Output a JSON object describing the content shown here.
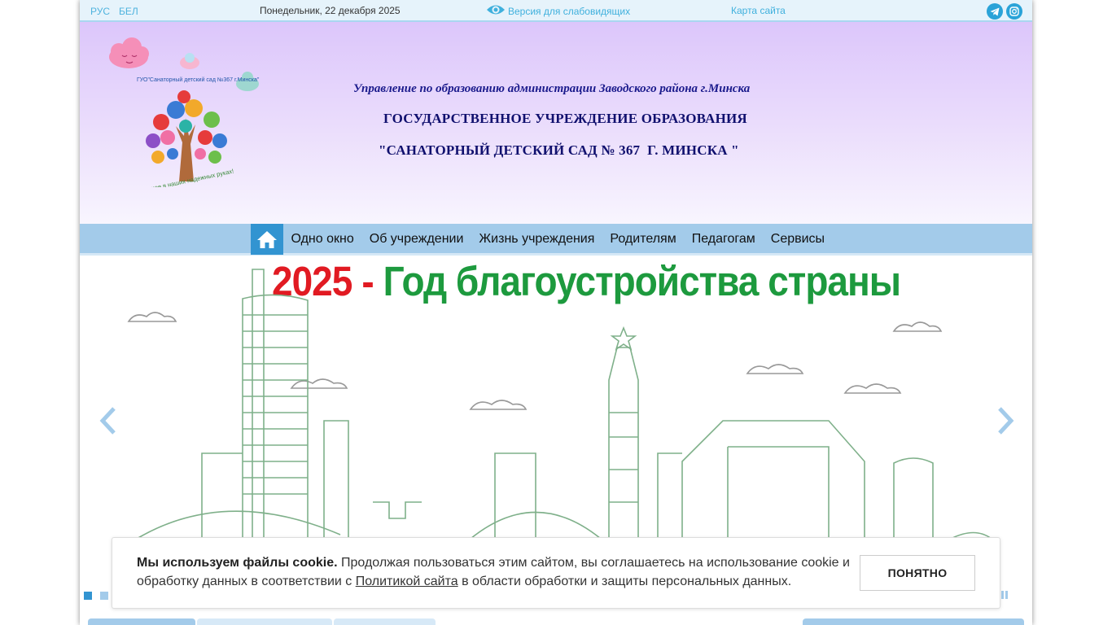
{
  "topbar": {
    "lang_ru": "РУС",
    "lang_be": "БЕЛ",
    "date": "Понедельник, 22 декабря 2025",
    "vision_label": "Версия для слабовидящих",
    "sitemap_label": "Карта сайта",
    "social": [
      {
        "name": "telegram-icon"
      },
      {
        "name": "instagram-icon"
      }
    ]
  },
  "header": {
    "subtitle": "Управление по образованию администрации Заводского района г.Минска",
    "title_line1": "ГОСУДАРСТВЕННОЕ УЧРЕЖДЕНИЕ ОБРАЗОВАНИЯ",
    "title_line2": "\"САНАТОРНЫЙ ДЕТСКИЙ САД № 367  Г. МИНСКА \"",
    "logo_text_top": "ГУО\"Санаторный детский сад №367 г.Минска\"",
    "logo_text_bottom": "Будущее в наших надежных руках!"
  },
  "nav": {
    "items": [
      {
        "label": "Одно окно"
      },
      {
        "label": "Об учреждении"
      },
      {
        "label": "Жизнь учреждения"
      },
      {
        "label": "Родителям"
      },
      {
        "label": "Педагогам"
      },
      {
        "label": "Сервисы"
      }
    ]
  },
  "banner": {
    "year": "2025",
    "dash": "-",
    "text": "Год благоустройства страны"
  },
  "cookie": {
    "bold": "Мы используем файлы cookie.",
    "text1": " Продолжая пользоваться этим сайтом, вы соглашаетесь на использование cookie и обработку данных в соответствии с ",
    "link": "Политикой сайта",
    "text2": " в области обработки и защиты персональных данных.",
    "button": "ПОНЯТНО"
  },
  "colors": {
    "accent": "#3294d1",
    "nav_bg": "#a3cbea",
    "header_title": "#10106e",
    "banner_red": "#e11a22",
    "banner_green": "#1d9a3e"
  }
}
